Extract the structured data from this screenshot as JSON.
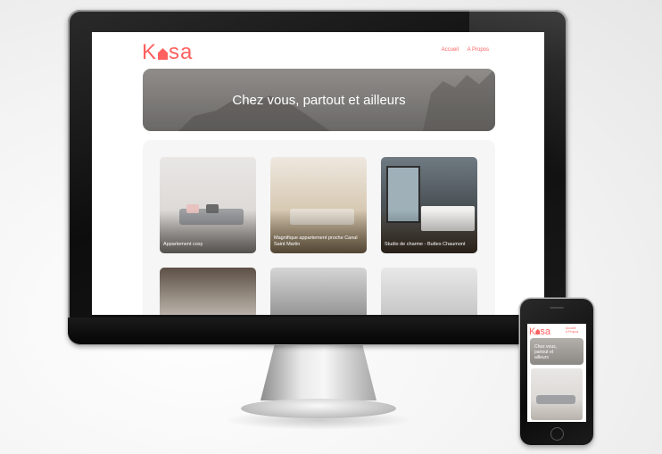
{
  "site": {
    "logo": {
      "before": "K",
      "after": "sa"
    },
    "nav": [
      "Accueil",
      "A Propos"
    ],
    "banner_title": "Chez vous, partout et ailleurs"
  },
  "gallery": [
    {
      "title": "Appartement cosy"
    },
    {
      "title": "Magnifique appartement proche Canal Saint Martin"
    },
    {
      "title": "Studio de charme - Buttes Chaumont"
    },
    {
      "title": ""
    },
    {
      "title": ""
    },
    {
      "title": ""
    }
  ],
  "mobile": {
    "nav": [
      "Accueil",
      "A Propos"
    ],
    "banner_title": "Chez vous, partout et ailleurs"
  },
  "colors": {
    "accent": "#ff6060",
    "background": "#ffffff",
    "gallery_bg": "#f6f6f6"
  }
}
